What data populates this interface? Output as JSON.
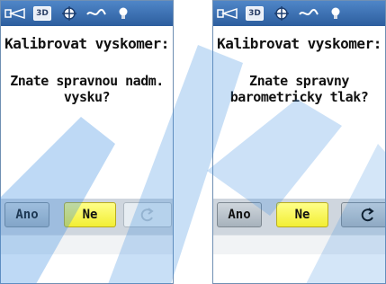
{
  "screens": [
    {
      "title": "Kalibrovat vyskomer:",
      "question": "Znate spravnou nadm.\nvysku?",
      "buttons": {
        "yes": "Ano",
        "no": "Ne",
        "reset_icon": "refresh-icon",
        "reset_enabled": false
      }
    },
    {
      "title": "Kalibrovat vyskomer:",
      "question": "Znate spravny\nbarometricky tlak?",
      "buttons": {
        "yes": "Ano",
        "no": "Ne",
        "reset_icon": "refresh-icon",
        "reset_enabled": true
      }
    }
  ],
  "status_bar": {
    "icons": [
      "battery-icon",
      "3d-fix-icon",
      "crosshair-icon",
      "signal-icon",
      "backlight-icon"
    ],
    "fix_label": "3D"
  },
  "colors": {
    "status_bar": "#3f74b8",
    "button_bar": "#cfd6de",
    "selected_button": "#f2ee34"
  }
}
